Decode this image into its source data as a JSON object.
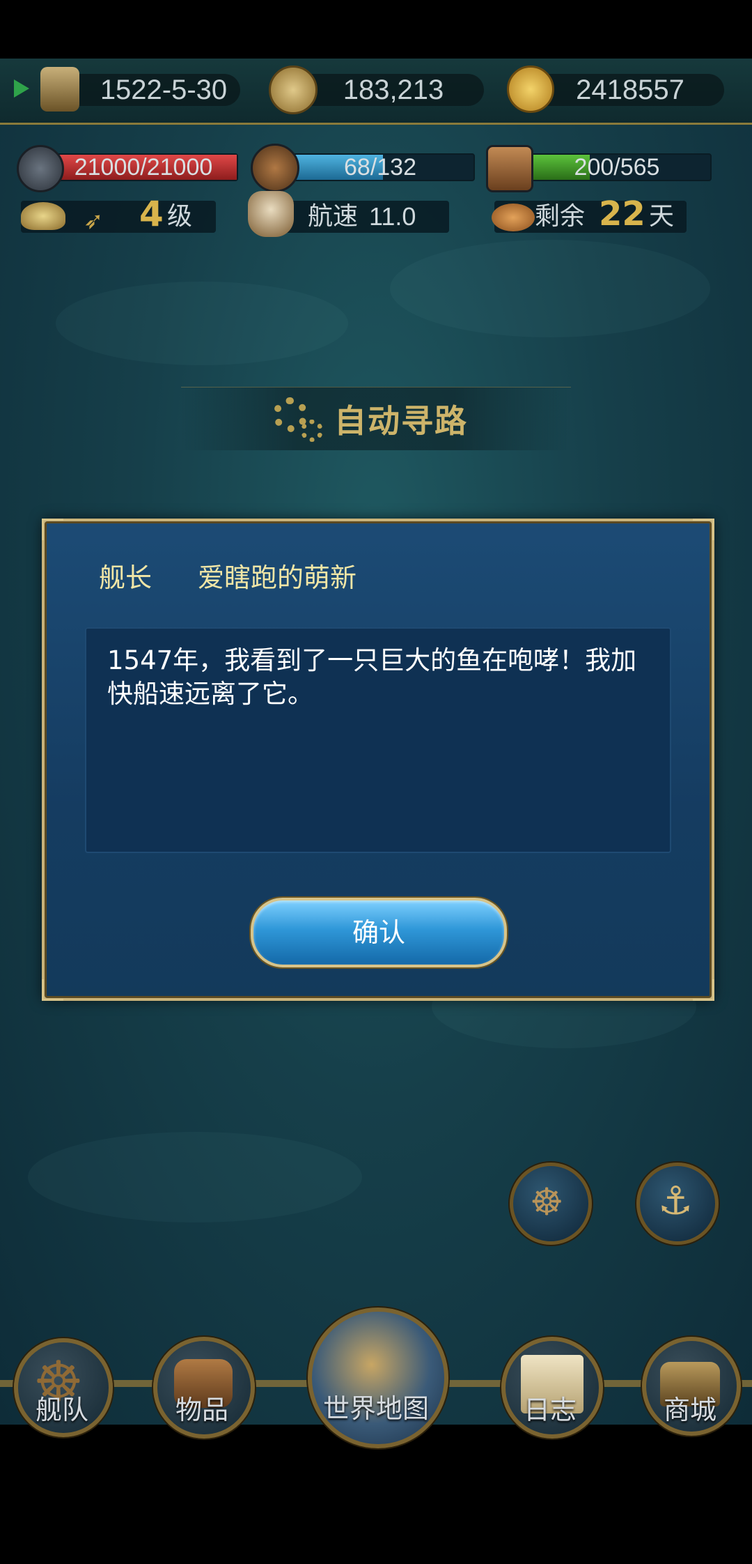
{
  "topbar": {
    "date": "1522-5-30",
    "explore": "183,213",
    "gold": "2418557"
  },
  "stats": {
    "durability": "21000/21000",
    "sailors": "68/132",
    "cargo": "200/565",
    "durability_ratio": 1.0,
    "sailors_ratio": 0.515,
    "cargo_ratio": 0.354,
    "wind_level": "4",
    "wind_unit": "级",
    "speed_label": "航速",
    "speed_value": "11.0",
    "supply_label": "剩余",
    "supply_days": "22",
    "supply_unit": "天"
  },
  "auto_path": {
    "label": "自动寻路"
  },
  "dialog": {
    "role_label": "舰长",
    "captain_name": "爱瞎跑的萌新",
    "message": "1547年，我看到了一只巨大的鱼在咆哮！我加快船速远离了它。",
    "confirm_label": "确认"
  },
  "bottom_nav": {
    "fleet": "舰队",
    "items": "物品",
    "world_map": "世界地图",
    "log": "日志",
    "shop": "商城"
  },
  "colors": {
    "hp_red": "#c22a2a",
    "sailor_blue": "#2d8fc0",
    "cargo_green": "#3f9a2c",
    "gold_text": "#d8b44c",
    "dialog_border": "#c9b37a"
  }
}
